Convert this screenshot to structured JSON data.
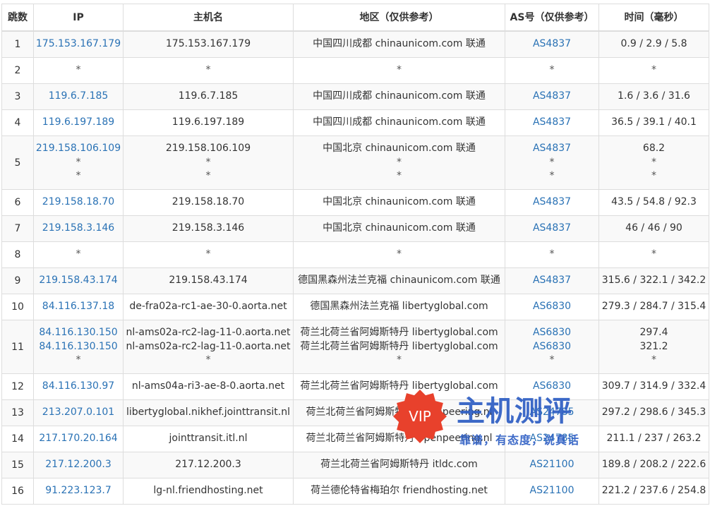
{
  "headers": [
    "跳数",
    "IP",
    "主机名",
    "地区（仅供参考）",
    "AS号（仅供参考）",
    "时间（毫秒）"
  ],
  "rows": [
    {
      "hop": "1",
      "ip": [
        "175.153.167.179"
      ],
      "host": [
        "175.153.167.179"
      ],
      "region": [
        "中国四川成都 chinaunicom.com 联通"
      ],
      "as": [
        "AS4837"
      ],
      "time": [
        "0.9 / 2.9 / 5.8"
      ]
    },
    {
      "hop": "2",
      "ip": [
        "*"
      ],
      "host": [
        "*"
      ],
      "region": [
        "*"
      ],
      "as": [
        "*"
      ],
      "time": [
        "*"
      ]
    },
    {
      "hop": "3",
      "ip": [
        "119.6.7.185"
      ],
      "host": [
        "119.6.7.185"
      ],
      "region": [
        "中国四川成都 chinaunicom.com 联通"
      ],
      "as": [
        "AS4837"
      ],
      "time": [
        "1.6 / 3.6 / 31.6"
      ]
    },
    {
      "hop": "4",
      "ip": [
        "119.6.197.189"
      ],
      "host": [
        "119.6.197.189"
      ],
      "region": [
        "中国四川成都 chinaunicom.com 联通"
      ],
      "as": [
        "AS4837"
      ],
      "time": [
        "36.5 / 39.1 / 40.1"
      ]
    },
    {
      "hop": "5",
      "ip": [
        "219.158.106.109",
        "*",
        "*"
      ],
      "host": [
        "219.158.106.109",
        "*",
        "*"
      ],
      "region": [
        "中国北京 chinaunicom.com 联通",
        "*",
        "*"
      ],
      "as": [
        "AS4837",
        "*",
        "*"
      ],
      "time": [
        "68.2",
        "*",
        "*"
      ]
    },
    {
      "hop": "6",
      "ip": [
        "219.158.18.70"
      ],
      "host": [
        "219.158.18.70"
      ],
      "region": [
        "中国北京 chinaunicom.com 联通"
      ],
      "as": [
        "AS4837"
      ],
      "time": [
        "43.5 / 54.8 / 92.3"
      ]
    },
    {
      "hop": "7",
      "ip": [
        "219.158.3.146"
      ],
      "host": [
        "219.158.3.146"
      ],
      "region": [
        "中国北京 chinaunicom.com 联通"
      ],
      "as": [
        "AS4837"
      ],
      "time": [
        "46 / 46 / 90"
      ]
    },
    {
      "hop": "8",
      "ip": [
        "*"
      ],
      "host": [
        "*"
      ],
      "region": [
        "*"
      ],
      "as": [
        "*"
      ],
      "time": [
        "*"
      ]
    },
    {
      "hop": "9",
      "ip": [
        "219.158.43.174"
      ],
      "host": [
        "219.158.43.174"
      ],
      "region": [
        "德国黑森州法兰克福 chinaunicom.com 联通"
      ],
      "as": [
        "AS4837"
      ],
      "time": [
        "315.6 / 322.1 / 342.2"
      ]
    },
    {
      "hop": "10",
      "ip": [
        "84.116.137.18"
      ],
      "host": [
        "de-fra02a-rc1-ae-30-0.aorta.net"
      ],
      "region": [
        "德国黑森州法兰克福 libertyglobal.com"
      ],
      "as": [
        "AS6830"
      ],
      "time": [
        "279.3 / 284.7 / 315.4"
      ]
    },
    {
      "hop": "11",
      "ip": [
        "84.116.130.150",
        "84.116.130.150",
        "*"
      ],
      "host": [
        "nl-ams02a-rc2-lag-11-0.aorta.net",
        "nl-ams02a-rc2-lag-11-0.aorta.net",
        "*"
      ],
      "region": [
        "荷兰北荷兰省阿姆斯特丹 libertyglobal.com",
        "荷兰北荷兰省阿姆斯特丹 libertyglobal.com",
        "*"
      ],
      "as": [
        "AS6830",
        "AS6830",
        "*"
      ],
      "time": [
        "297.4",
        "321.2",
        "*"
      ]
    },
    {
      "hop": "12",
      "ip": [
        "84.116.130.97"
      ],
      "host": [
        "nl-ams04a-ri3-ae-8-0.aorta.net"
      ],
      "region": [
        "荷兰北荷兰省阿姆斯特丹 libertyglobal.com"
      ],
      "as": [
        "AS6830"
      ],
      "time": [
        "309.7 / 314.9 / 332.4"
      ]
    },
    {
      "hop": "13",
      "ip": [
        "213.207.0.101"
      ],
      "host": [
        "libertyglobal.nikhef.jointtransit.nl"
      ],
      "region": [
        "荷兰北荷兰省阿姆斯特丹 openpeering.nl"
      ],
      "as": [
        "AS24785"
      ],
      "time": [
        "297.2 / 298.6 / 345.3"
      ]
    },
    {
      "hop": "14",
      "ip": [
        "217.170.20.164"
      ],
      "host": [
        "jointtransit.itl.nl"
      ],
      "region": [
        "荷兰北荷兰省阿姆斯特丹 openpeering.nl"
      ],
      "as": [
        "AS24785"
      ],
      "time": [
        "211.1 / 237 / 263.2"
      ]
    },
    {
      "hop": "15",
      "ip": [
        "217.12.200.3"
      ],
      "host": [
        "217.12.200.3"
      ],
      "region": [
        "荷兰北荷兰省阿姆斯特丹 itldc.com"
      ],
      "as": [
        "AS21100"
      ],
      "time": [
        "189.8 / 208.2 / 222.6"
      ]
    },
    {
      "hop": "16",
      "ip": [
        "91.223.123.7"
      ],
      "host": [
        "lg-nl.friendhosting.net"
      ],
      "region": [
        "荷兰德伦特省梅珀尔 friendhosting.net"
      ],
      "as": [
        "AS21100"
      ],
      "time": [
        "221.2 / 237.6 / 254.8"
      ]
    }
  ],
  "watermark": {
    "badge": "VIP",
    "title": "主机测评",
    "slogan": "靠谱，有态度，说真话",
    "colors": {
      "badge": "#e8412c",
      "text": "#2f5fc4"
    }
  },
  "colors": {
    "link": "#2a72b5",
    "border": "#dddddd",
    "stripe": "#f9f9f9"
  }
}
